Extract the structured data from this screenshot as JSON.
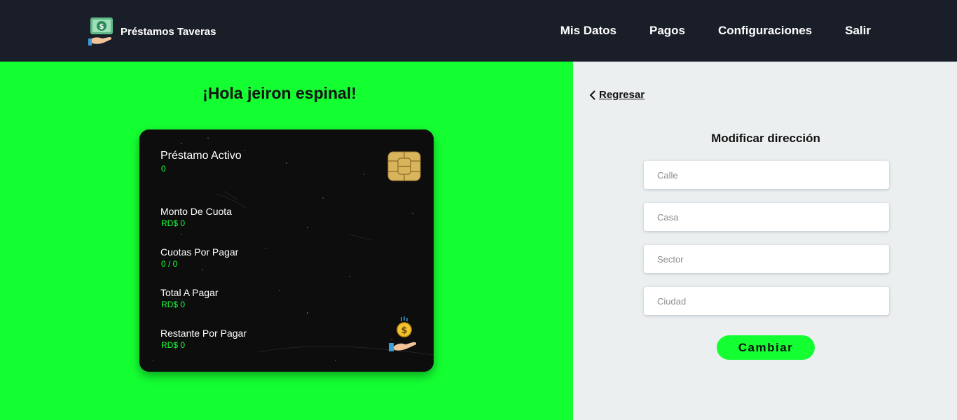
{
  "brand": {
    "name": "Préstamos Taveras",
    "logo_icon": "money-hand-icon"
  },
  "nav": {
    "items": [
      "Mis Datos",
      "Pagos",
      "Configuraciones",
      "Salir"
    ]
  },
  "greeting": "¡Hola jeiron espinal!",
  "card": {
    "items": [
      {
        "label": "Préstamo Activo",
        "value": "0"
      },
      {
        "label": "Monto De Cuota",
        "value": "RD$ 0"
      },
      {
        "label": "Cuotas Por Pagar",
        "value": "0 / 0"
      },
      {
        "label": "Total A Pagar",
        "value": "RD$ 0"
      },
      {
        "label": "Restante Por Pagar",
        "value": "RD$ 0"
      }
    ],
    "chip_icon": "card-chip-icon",
    "payment_icon": "coin-hand-icon"
  },
  "form": {
    "back_label": "Regresar",
    "title": "Modificar dirección",
    "fields": [
      {
        "placeholder": "Calle",
        "value": ""
      },
      {
        "placeholder": "Casa",
        "value": ""
      },
      {
        "placeholder": "Sector",
        "value": ""
      },
      {
        "placeholder": "Ciudad",
        "value": ""
      }
    ],
    "submit_label": "Cambiar"
  },
  "colors": {
    "navbar": "#1a1e28",
    "accent_green": "#14ff32",
    "card_bg": "#0d0d0e",
    "card_value": "#1aff3a",
    "form_bg": "#eceff0"
  }
}
